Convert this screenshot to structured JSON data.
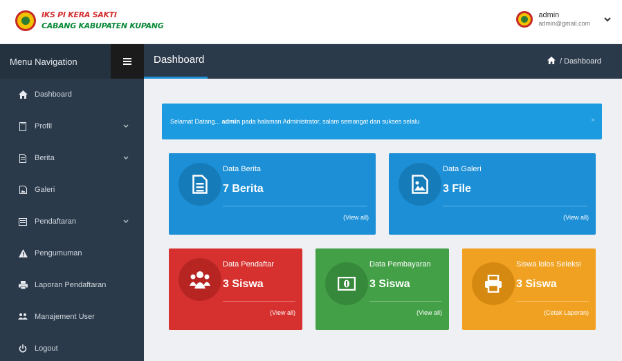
{
  "header": {
    "brand_line1": "IKS PI KERA SAKTI",
    "brand_line2": "CABANG KABUPATEN KUPANG",
    "user_name": "admin",
    "user_email": "admin@gmail.com"
  },
  "sidebar": {
    "title": "Menu Navigation",
    "items": [
      {
        "label": "Dashboard",
        "icon": "home-icon"
      },
      {
        "label": "Profil",
        "icon": "book-icon",
        "has_submenu": true
      },
      {
        "label": "Berita",
        "icon": "document-icon",
        "has_submenu": true
      },
      {
        "label": "Galeri",
        "icon": "image-icon"
      },
      {
        "label": "Pendaftaran",
        "icon": "form-icon",
        "has_submenu": true
      },
      {
        "label": "Pengumuman",
        "icon": "warning-icon"
      },
      {
        "label": "Laporan Pendaftaran",
        "icon": "printer-icon"
      },
      {
        "label": "Manajement User",
        "icon": "users-icon"
      },
      {
        "label": "Logout",
        "icon": "power-icon"
      }
    ]
  },
  "page": {
    "title": "Dashboard",
    "breadcrumb": "/ Dashboard"
  },
  "alert": {
    "prefix": "Selamat Datang... ",
    "user": "admin",
    "suffix": " pada halaman Administrator, salam semangat dan sukses selalu",
    "close": "×"
  },
  "cards": {
    "berita": {
      "title": "Data Berita",
      "value": "7 Berita",
      "link": "(View all)",
      "color": "#1c8fd6"
    },
    "galeri": {
      "title": "Data Galeri",
      "value": "3 File",
      "link": "(View all)",
      "color": "#1c8fd6"
    },
    "pendaftar": {
      "title": "Data Pendaftar",
      "value": "3 Siswa",
      "link": "(View all)",
      "color": "#d6312f"
    },
    "pembayaran": {
      "title": "Data Pembayaran",
      "value": "3 Siswa",
      "link": "(View all)",
      "color": "#43a047"
    },
    "lolos": {
      "title": "Siswa lolos Seleksi",
      "value": "3 Siswa",
      "link": "(Cetak Laporan)",
      "color": "#f0a121"
    }
  }
}
